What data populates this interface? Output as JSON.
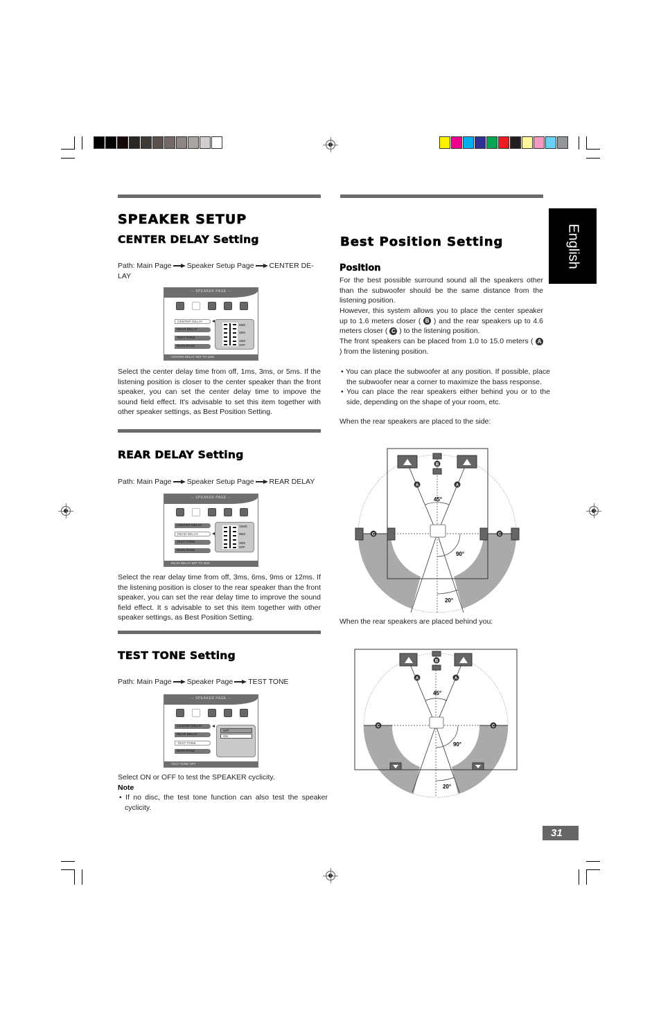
{
  "print_marks": {
    "grayscale_swatches": [
      "#000000",
      "#030303",
      "#140808",
      "#2a2624",
      "#403a36",
      "#5a514d",
      "#736a67",
      "#8c8583",
      "#aaa4a3",
      "#d2cdcc",
      "#ffffff"
    ],
    "color_swatches": [
      "#fff100",
      "#ec008c",
      "#00aeef",
      "#2e3192",
      "#00a651",
      "#ed1c24",
      "#231f20",
      "#fff799",
      "#f49ac1",
      "#6dcff6",
      "#939598"
    ]
  },
  "side_tab": {
    "label": "English"
  },
  "page_number": "31",
  "left": {
    "title": "SPEAKER SETUP",
    "center_delay": {
      "heading": "CENTER DELAY Setting",
      "path_prefix": "Path: Main Page",
      "path_steps": [
        "Speaker Setup Page",
        "CENTER DE-LAY"
      ],
      "screen": {
        "header": "-- SPEAKER  PAGE --",
        "menu": [
          "CENTER DELAY",
          "REAR DELAY",
          "TEST TONE",
          "MAIN PAGE"
        ],
        "selected_index": 0,
        "scale": [
          "5MS",
          "3MS",
          "1MS",
          "OFF"
        ],
        "footer": "CENTER DELAY SET TO  1MS"
      },
      "description": "Select the center delay time from off, 1ms, 3ms, or 5ms. If the listening position is closer to the center speaker than the front speaker, you can set the center delay time to impove the sound field effect. It's advisable to set this item together with other speaker settings, as Best Position Setting."
    },
    "rear_delay": {
      "heading": "REAR DELAY Setting",
      "path_prefix": "Path: Main Page",
      "path_steps": [
        "Speaker Setup Page",
        "REAR DELAY"
      ],
      "screen": {
        "header": "-- SPEAKER  PAGE --",
        "menu": [
          "CENTER DELAY",
          "REAR DELAY",
          "TEST TONE",
          "MAIN PAGE"
        ],
        "selected_index": 1,
        "scale": [
          "15MS",
          "9MS",
          "3MS",
          "OFF"
        ],
        "footer": "REAR DELAY SET TO 9MS"
      },
      "description": "Select the rear delay time from off, 3ms, 6ms, 9ms or 12ms. If the listening position is closer to the rear speaker than the front speaker, you can set the rear delay time to improve the sound field effect. It s advisable to set this item together with other speaker settings, as Best Position Setting."
    },
    "test_tone": {
      "heading": "TEST TONE Setting",
      "path_prefix": "Path: Main Page",
      "path_steps": [
        "Speaker Page",
        "TEST TONE"
      ],
      "screen": {
        "header": "-- SPEAKER  PAGE --",
        "menu": [
          "CENTER DELAY",
          "REAR DELAY",
          "TEST TONE",
          "MAIN PAGE"
        ],
        "selected_index": 2,
        "options": [
          "OFF",
          "ON"
        ],
        "footer": "TEST TONE OFF"
      },
      "description": "Select ON or OFF to test the SPEAKER cyclicity.",
      "note_label": "Note",
      "note_bullet": "If no disc, the test tone function can also test the speaker cyclicity."
    }
  },
  "right": {
    "title": "Best Position Setting",
    "position_heading": "Position",
    "para1": "For the best possible surround sound all the speakers other than the subwoofer should be the same distance from the listening position.",
    "para2_a": "However, this system allows you to place the center speaker up to 1.6 meters closer (",
    "para2_b": ") and the rear speakers up to 4.6 meters closer (",
    "para2_c": ") to the listening position.",
    "para3_a": "The front speakers can be placed from 1.0 to 15.0 meters (",
    "para3_b": ") from the listening position.",
    "markers": {
      "a": "A",
      "b": "B",
      "c": "C"
    },
    "bullets": [
      "You can place the subwoofer at any position. If possible, place the subwoofer near a corner to maximize the bass response.",
      "You can place the rear speakers either behind you or to the side, depending on the shape of your room, etc."
    ],
    "caption_side": "When the rear speakers are placed to the side:",
    "caption_behind": "When the rear speakers are placed behind you:",
    "diagram_labels": {
      "front_angle": "45°",
      "side_angle": "90°",
      "rear_angle": "20°"
    }
  }
}
